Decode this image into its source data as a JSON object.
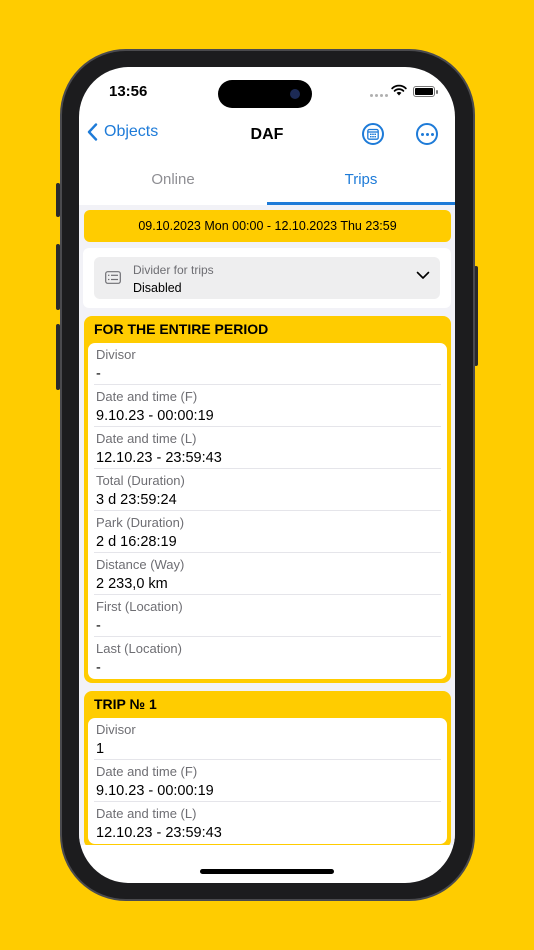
{
  "status": {
    "time": "13:56"
  },
  "nav": {
    "back_label": "Objects",
    "title": "DAF"
  },
  "tabs": [
    {
      "label": "Online",
      "active": false
    },
    {
      "label": "Trips",
      "active": true
    }
  ],
  "period": {
    "text": "09.10.2023 Mon 00:00  -  12.10.2023 Thu 23:59"
  },
  "divider": {
    "label": "Divider for trips",
    "value": "Disabled"
  },
  "cards": [
    {
      "title": "FOR THE ENTIRE PERIOD",
      "rows": [
        {
          "label": "Divisor",
          "value": "-"
        },
        {
          "label": "Date and time (F)",
          "value": "9.10.23 - 00:00:19"
        },
        {
          "label": "Date and time (L)",
          "value": "12.10.23 - 23:59:43"
        },
        {
          "label": "Total (Duration)",
          "value": "3 d 23:59:24"
        },
        {
          "label": "Park (Duration)",
          "value": "2 d 16:28:19"
        },
        {
          "label": "Distance (Way)",
          "value": "2 233,0 km"
        },
        {
          "label": "First (Location)",
          "value": "-"
        },
        {
          "label": "Last (Location)",
          "value": "-"
        }
      ]
    },
    {
      "title": "TRIP № 1",
      "rows": [
        {
          "label": "Divisor",
          "value": "1"
        },
        {
          "label": "Date and time (F)",
          "value": "9.10.23 - 00:00:19"
        },
        {
          "label": "Date and time (L)",
          "value": "12.10.23 - 23:59:43"
        }
      ]
    }
  ],
  "colors": {
    "accent": "#1e7bd8",
    "brand": "#FFCC00"
  }
}
